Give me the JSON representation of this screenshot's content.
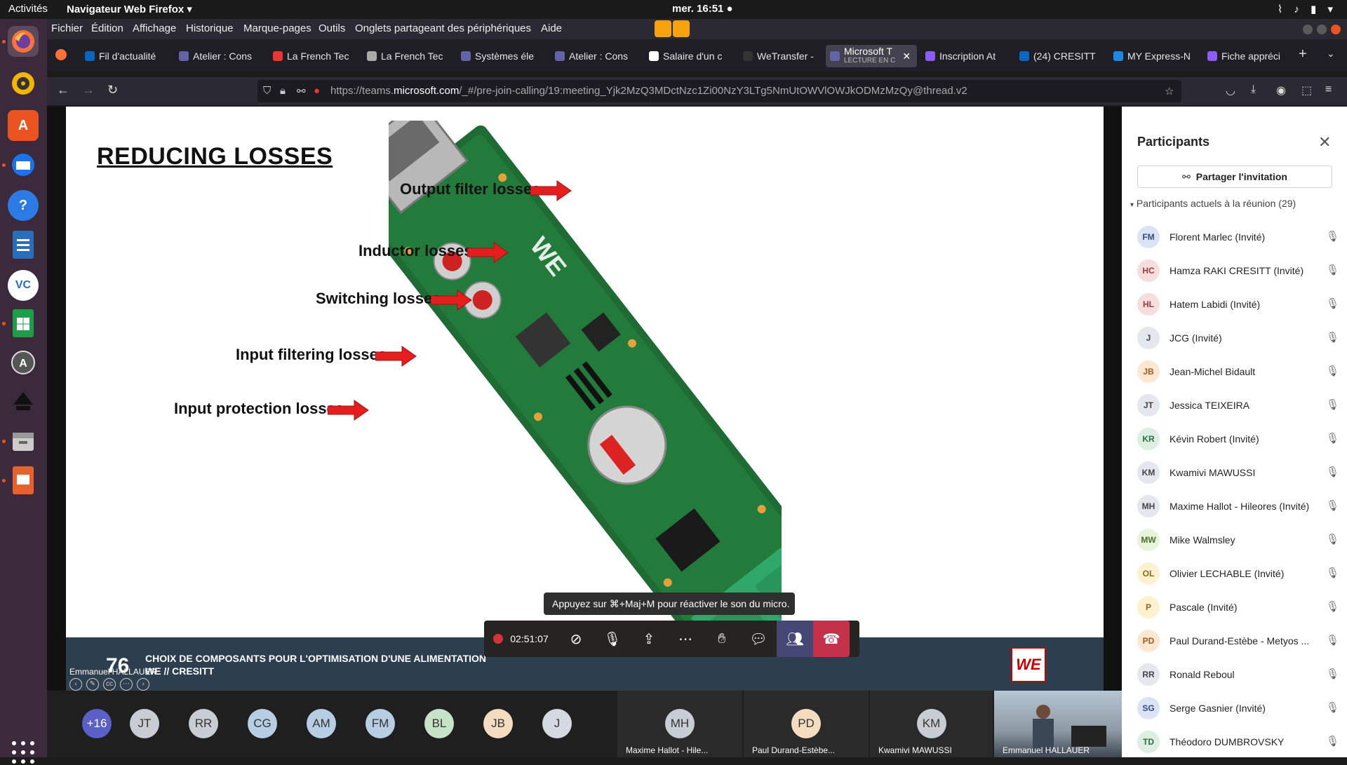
{
  "topbar": {
    "activities": "Activités",
    "app": "Navigateur Web Firefox ▾",
    "clock": "mer. 16:51 ●"
  },
  "menu": [
    "Fichier",
    "Édition",
    "Affichage",
    "Historique",
    "Marque-pages",
    "Outils",
    "Onglets partageant des périphériques",
    "Aide"
  ],
  "tabs": [
    {
      "label": "Fil d'actualité",
      "color": "#0a66c2"
    },
    {
      "label": "Atelier : Cons",
      "color": "#6264a7"
    },
    {
      "label": "La French Tec",
      "color": "#e33"
    },
    {
      "label": "La French Tec",
      "color": "#aaa"
    },
    {
      "label": "Systèmes éle",
      "color": "#6264a7"
    },
    {
      "label": "Atelier : Cons",
      "color": "#6264a7"
    },
    {
      "label": "Salaire d'un c",
      "color": "#fff"
    },
    {
      "label": "WeTransfer -",
      "color": "#333"
    },
    {
      "label": "Microsoft T",
      "sub": "LECTURE EN C",
      "color": "#6264a7"
    },
    {
      "label": "Inscription At",
      "color": "#8b5cf6"
    },
    {
      "label": "(24) CRESITT",
      "color": "#0a66c2"
    },
    {
      "label": "MY Express-N",
      "color": "#1e88e5"
    },
    {
      "label": "Fiche appréci",
      "color": "#8b5cf6"
    }
  ],
  "url": {
    "prefix": "https://teams.",
    "domain": "microsoft.com",
    "rest": "/_#/pre-join-calling/19:meeting_Yjk2MzQ3MDctNzc1Zi00NzY3LTg5NmUtOWVlOWJkODMzMzQy@thread.v2"
  },
  "slide": {
    "title": "REDUCING LOSSES",
    "labels": [
      "Output filter losses",
      "Inductor losses",
      "Switching losses",
      "Input filtering losses",
      "Input protection losses"
    ],
    "number": "76",
    "footer1": "CHOIX DE COMPOSANTS POUR L'OPTIMISATION D'UNE ALIMENTATION",
    "footer2": "WE // CRESITT",
    "presenter": "Emmanuel HALLAUER",
    "logo": "WE"
  },
  "toast": "Appuyez sur ⌘+Maj+M pour réactiver le son du micro.",
  "call": {
    "timer": "02:51:07"
  },
  "strip": {
    "avatars": [
      {
        "initials": "+16",
        "color": "#5b5fc7",
        "text": "#fff"
      },
      {
        "initials": "JT",
        "color": "#c8cdd3",
        "text": "#333"
      },
      {
        "initials": "RR",
        "color": "#c8cdd3",
        "text": "#333"
      },
      {
        "initials": "CG",
        "color": "#b7cde3",
        "text": "#333"
      },
      {
        "initials": "AM",
        "color": "#b7cde3",
        "text": "#333"
      },
      {
        "initials": "FM",
        "color": "#b7cde3",
        "text": "#333"
      },
      {
        "initials": "BL",
        "color": "#c7e3c7",
        "text": "#333"
      },
      {
        "initials": "JB",
        "color": "#f4dcc1",
        "text": "#333"
      },
      {
        "initials": "J",
        "color": "#d5d9e2",
        "text": "#333"
      }
    ],
    "tiles": [
      {
        "initials": "MH",
        "name": "Maxime Hallot - Hile...",
        "color": "#c8cdd3"
      },
      {
        "initials": "PD",
        "name": "Paul Durand-Estèbe...",
        "color": "#f4dcc1"
      },
      {
        "initials": "KM",
        "name": "Kwamivi MAWUSSI",
        "color": "#c8cdd3"
      }
    ],
    "video_name": "Emmanuel HALLAUER"
  },
  "panel": {
    "title": "Participants",
    "share": "Partager l'invitation",
    "section": "Participants actuels à la réunion",
    "count": "(29)",
    "people": [
      {
        "initials": "FM",
        "name": "Florent Marlec (Invité)",
        "bg": "#dbe4f5",
        "fg": "#2f4b8a"
      },
      {
        "initials": "HC",
        "name": "Hamza RAKI CRESITT (Invité)",
        "bg": "#f6dede",
        "fg": "#9a3b3b"
      },
      {
        "initials": "HL",
        "name": "Hatem Labidi (Invité)",
        "bg": "#f6dede",
        "fg": "#9a3b3b"
      },
      {
        "initials": "J",
        "name": "JCG (Invité)",
        "bg": "#e4e7ee",
        "fg": "#444"
      },
      {
        "initials": "JB",
        "name": "Jean-Michel Bidault",
        "bg": "#fbe7d2",
        "fg": "#a05a1c"
      },
      {
        "initials": "JT",
        "name": "Jessica TEIXEIRA",
        "bg": "#e4e7ee",
        "fg": "#444"
      },
      {
        "initials": "KR",
        "name": "Kévin Robert (Invité)",
        "bg": "#dcefe2",
        "fg": "#2f6d44"
      },
      {
        "initials": "KM",
        "name": "Kwamivi MAWUSSI",
        "bg": "#e4e7ee",
        "fg": "#444"
      },
      {
        "initials": "MH",
        "name": "Maxime Hallot - Hileores (Invité)",
        "bg": "#e4e7ee",
        "fg": "#444"
      },
      {
        "initials": "MW",
        "name": "Mike Walmsley",
        "bg": "#e8f3dc",
        "fg": "#4a6d2a"
      },
      {
        "initials": "OL",
        "name": "Olivier LECHABLE (Invité)",
        "bg": "#fdf1cf",
        "fg": "#8a6a12"
      },
      {
        "initials": "P",
        "name": "Pascale (Invité)",
        "bg": "#fdf1cf",
        "fg": "#8a6a12"
      },
      {
        "initials": "PD",
        "name": "Paul Durand-Estèbe - Metyos ...",
        "bg": "#fbe7d2",
        "fg": "#a05a1c"
      },
      {
        "initials": "RR",
        "name": "Ronald Reboul",
        "bg": "#e4e7ee",
        "fg": "#444"
      },
      {
        "initials": "SG",
        "name": "Serge Gasnier (Invité)",
        "bg": "#dbe4f5",
        "fg": "#2f4b8a"
      },
      {
        "initials": "TD",
        "name": "Théodoro DUMBROVSKY",
        "bg": "#dcefe2",
        "fg": "#2f6d44"
      }
    ]
  }
}
